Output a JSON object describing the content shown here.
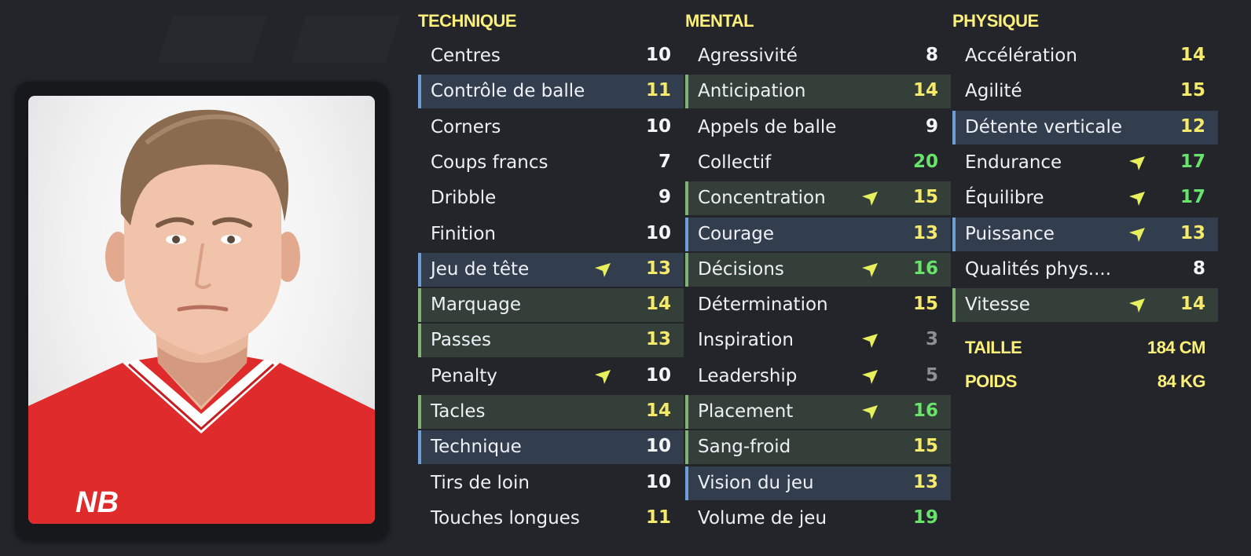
{
  "colors": {
    "header": "#fbf07a",
    "value_white": "#f4f5f7",
    "value_yellow": "#f5ea6a",
    "value_green": "#69e46a",
    "value_grey": "#8d9097",
    "highlight_blue": "#323d4e",
    "highlight_green": "#333f38",
    "arrow": "#e8ef5c"
  },
  "columns": [
    {
      "title": "TECHNIQUE",
      "attributes": [
        {
          "label": "Centres",
          "value": "10",
          "color": "white",
          "highlight": "none",
          "arrow": false
        },
        {
          "label": "Contrôle de balle",
          "value": "11",
          "color": "yellow",
          "highlight": "blue",
          "arrow": false
        },
        {
          "label": "Corners",
          "value": "10",
          "color": "white",
          "highlight": "none",
          "arrow": false
        },
        {
          "label": "Coups francs",
          "value": "7",
          "color": "white",
          "highlight": "none",
          "arrow": false
        },
        {
          "label": "Dribble",
          "value": "9",
          "color": "white",
          "highlight": "none",
          "arrow": false
        },
        {
          "label": "Finition",
          "value": "10",
          "color": "white",
          "highlight": "none",
          "arrow": false
        },
        {
          "label": "Jeu de tête",
          "value": "13",
          "color": "yellow",
          "highlight": "blue",
          "arrow": true
        },
        {
          "label": "Marquage",
          "value": "14",
          "color": "yellow",
          "highlight": "green",
          "arrow": false
        },
        {
          "label": "Passes",
          "value": "13",
          "color": "yellow",
          "highlight": "green",
          "arrow": false
        },
        {
          "label": "Penalty",
          "value": "10",
          "color": "white",
          "highlight": "none",
          "arrow": true
        },
        {
          "label": "Tacles",
          "value": "14",
          "color": "yellow",
          "highlight": "green",
          "arrow": false
        },
        {
          "label": "Technique",
          "value": "10",
          "color": "white",
          "highlight": "blue",
          "arrow": false
        },
        {
          "label": "Tirs de loin",
          "value": "10",
          "color": "white",
          "highlight": "none",
          "arrow": false
        },
        {
          "label": "Touches longues",
          "value": "11",
          "color": "yellow",
          "highlight": "none",
          "arrow": false
        }
      ]
    },
    {
      "title": "MENTAL",
      "attributes": [
        {
          "label": "Agressivité",
          "value": "8",
          "color": "white",
          "highlight": "none",
          "arrow": false
        },
        {
          "label": "Anticipation",
          "value": "14",
          "color": "yellow",
          "highlight": "green",
          "arrow": false
        },
        {
          "label": "Appels de balle",
          "value": "9",
          "color": "white",
          "highlight": "none",
          "arrow": false
        },
        {
          "label": "Collectif",
          "value": "20",
          "color": "green",
          "highlight": "none",
          "arrow": false
        },
        {
          "label": "Concentration",
          "value": "15",
          "color": "yellow",
          "highlight": "green",
          "arrow": true
        },
        {
          "label": "Courage",
          "value": "13",
          "color": "yellow",
          "highlight": "blue",
          "arrow": false
        },
        {
          "label": "Décisions",
          "value": "16",
          "color": "green",
          "highlight": "green",
          "arrow": true
        },
        {
          "label": "Détermination",
          "value": "15",
          "color": "yellow",
          "highlight": "none",
          "arrow": false
        },
        {
          "label": "Inspiration",
          "value": "3",
          "color": "grey",
          "highlight": "none",
          "arrow": true
        },
        {
          "label": "Leadership",
          "value": "5",
          "color": "grey",
          "highlight": "none",
          "arrow": true
        },
        {
          "label": "Placement",
          "value": "16",
          "color": "green",
          "highlight": "green",
          "arrow": true
        },
        {
          "label": "Sang-froid",
          "value": "15",
          "color": "yellow",
          "highlight": "green",
          "arrow": false
        },
        {
          "label": "Vision du jeu",
          "value": "13",
          "color": "yellow",
          "highlight": "blue",
          "arrow": false
        },
        {
          "label": "Volume de jeu",
          "value": "19",
          "color": "green",
          "highlight": "none",
          "arrow": false
        }
      ]
    },
    {
      "title": "PHYSIQUE",
      "attributes": [
        {
          "label": "Accélération",
          "value": "14",
          "color": "yellow",
          "highlight": "none",
          "arrow": false
        },
        {
          "label": "Agilité",
          "value": "15",
          "color": "yellow",
          "highlight": "none",
          "arrow": false
        },
        {
          "label": "Détente verticale",
          "value": "12",
          "color": "yellow",
          "highlight": "blue",
          "arrow": false
        },
        {
          "label": "Endurance",
          "value": "17",
          "color": "green",
          "highlight": "none",
          "arrow": true
        },
        {
          "label": "Équilibre",
          "value": "17",
          "color": "green",
          "highlight": "none",
          "arrow": true
        },
        {
          "label": "Puissance",
          "value": "13",
          "color": "yellow",
          "highlight": "blue",
          "arrow": true
        },
        {
          "label": "Qualités phys....",
          "value": "8",
          "color": "white",
          "highlight": "none",
          "arrow": false
        },
        {
          "label": "Vitesse",
          "value": "14",
          "color": "yellow",
          "highlight": "green",
          "arrow": true
        }
      ]
    }
  ],
  "physical": {
    "height_label": "TAILLE",
    "height_value": "184 CM",
    "weight_label": "POIDS",
    "weight_value": "84 KG"
  },
  "photo": {
    "icon": "player-portrait",
    "shirt_color": "#e02b2c",
    "sponsor_logo": "NB"
  }
}
